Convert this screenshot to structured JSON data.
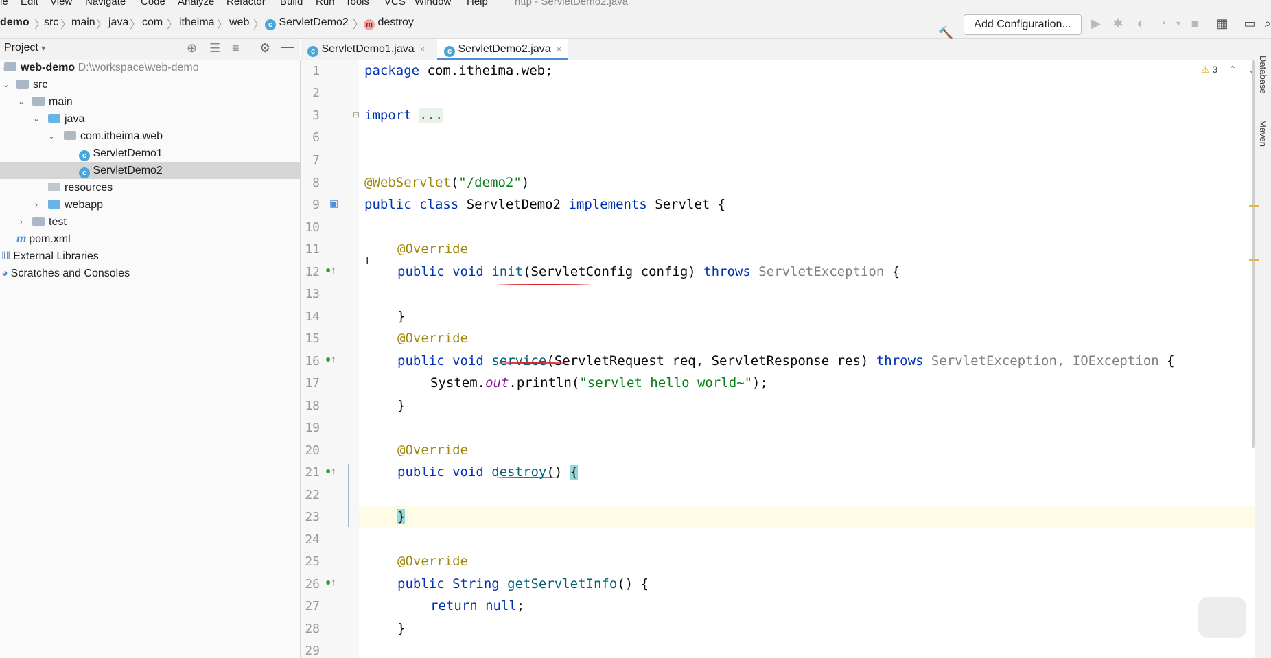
{
  "menu": [
    "le",
    "Edit",
    "View",
    "Navigate",
    "Code",
    "Analyze",
    "Refactor",
    "Build",
    "Run",
    "Tools",
    "VCS",
    "Window",
    "Help",
    "http - ServletDemo2.java"
  ],
  "breadcrumb": [
    "demo",
    "src",
    "main",
    "java",
    "com",
    "itheima",
    "web",
    "ServletDemo2",
    "destroy"
  ],
  "toolbar": {
    "add_configuration": "Add Configuration..."
  },
  "project": {
    "title": "Project",
    "dropdown": "▾",
    "tree": [
      {
        "label": "web-demo",
        "path": "D:\\workspace\\web-demo"
      },
      {
        "label": "src"
      },
      {
        "label": "main"
      },
      {
        "label": "java"
      },
      {
        "label": "com.itheima.web"
      },
      {
        "label": "ServletDemo1"
      },
      {
        "label": "ServletDemo2"
      },
      {
        "label": "resources"
      },
      {
        "label": "webapp"
      },
      {
        "label": "test"
      },
      {
        "label": "pom.xml"
      },
      {
        "label": "External Libraries"
      },
      {
        "label": "Scratches and Consoles"
      }
    ]
  },
  "tabs": [
    {
      "label": "ServletDemo1.java",
      "close": "×"
    },
    {
      "label": "ServletDemo2.java",
      "close": "×"
    }
  ],
  "inspections": {
    "warnings": "3"
  },
  "right_tools": [
    "Database",
    "Maven"
  ],
  "code": {
    "line_numbers": [
      "1",
      "2",
      "3",
      "6",
      "7",
      "8",
      "9",
      "10",
      "11",
      "12",
      "13",
      "14",
      "15",
      "16",
      "17",
      "18",
      "19",
      "20",
      "21",
      "22",
      "23",
      "24",
      "25",
      "26",
      "27",
      "28",
      "29"
    ],
    "package_kw": "package",
    "package_name": " com.itheima.web;",
    "import_kw": "import",
    "import_fold": "...",
    "webservlet_ann": "@WebServlet",
    "webservlet_open": "(",
    "webservlet_str": "\"/demo2\"",
    "webservlet_close": ")",
    "class_mods": "public class",
    "class_name": " ServletDemo2 ",
    "implements_kw": "implements",
    "class_tail": " Servlet {",
    "override": "@Override",
    "public_void": "public void",
    "init_name": "init",
    "init_params": "(ServletConfig config) ",
    "throws_kw": "throws",
    "servlet_exc": " ServletException",
    "brace_open": " {",
    "close_brace": "}",
    "service_name": "service",
    "service_params": "(ServletRequest req, ServletResponse res) ",
    "io_exc": ", IOException",
    "sys_out": "System.",
    "out_field": "out",
    "println_open": ".println(",
    "hello_str": "\"servlet hello world~\"",
    "println_close": ");",
    "destroy_name": "destroy",
    "empty_params": "() ",
    "brace_only": "{",
    "public_string": "public String",
    "getinfo_name": " getServletInfo",
    "getinfo_tail": "() {",
    "return_kw": "return null",
    "semicolon": ";"
  }
}
